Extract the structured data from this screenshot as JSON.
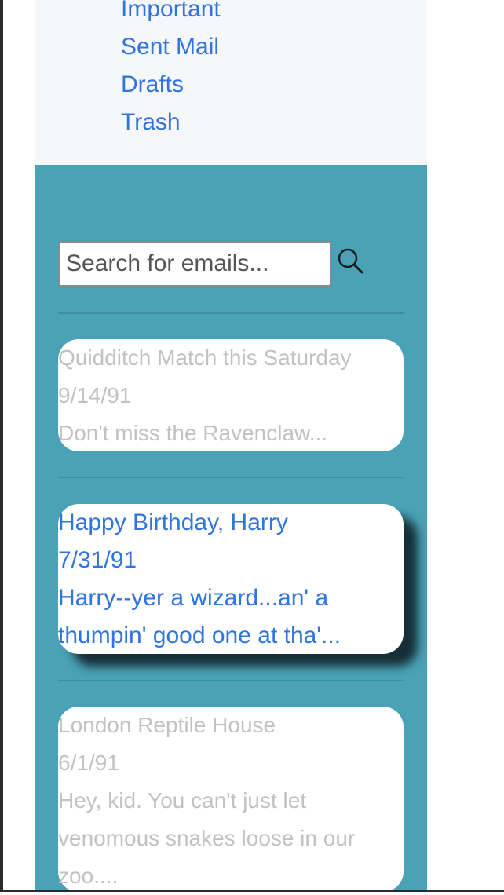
{
  "nav": {
    "items": [
      {
        "label": "Important"
      },
      {
        "label": "Sent Mail"
      },
      {
        "label": "Drafts"
      },
      {
        "label": "Trash"
      }
    ]
  },
  "search": {
    "placeholder": "Search for emails...",
    "icon": "search-icon"
  },
  "emails": [
    {
      "subject": "Quidditch Match this Saturday",
      "date": "9/14/91",
      "preview": "Don't miss the Ravenclaw...",
      "state": "read"
    },
    {
      "subject": "Happy Birthday, Harry",
      "date": "7/31/91",
      "preview": "Harry--yer a wizard...an' a thumpin' good one at tha'...",
      "state": "selected"
    },
    {
      "subject": "London Reptile House",
      "date": "6/1/91",
      "preview": "Hey, kid. You can't just let venomous snakes loose in our zoo....",
      "state": "read"
    }
  ],
  "colors": {
    "panel_bg": "#49a2b6",
    "nav_bg": "#f6f7f9",
    "link": "#2f74e0",
    "muted_text": "#c2c2c2"
  }
}
